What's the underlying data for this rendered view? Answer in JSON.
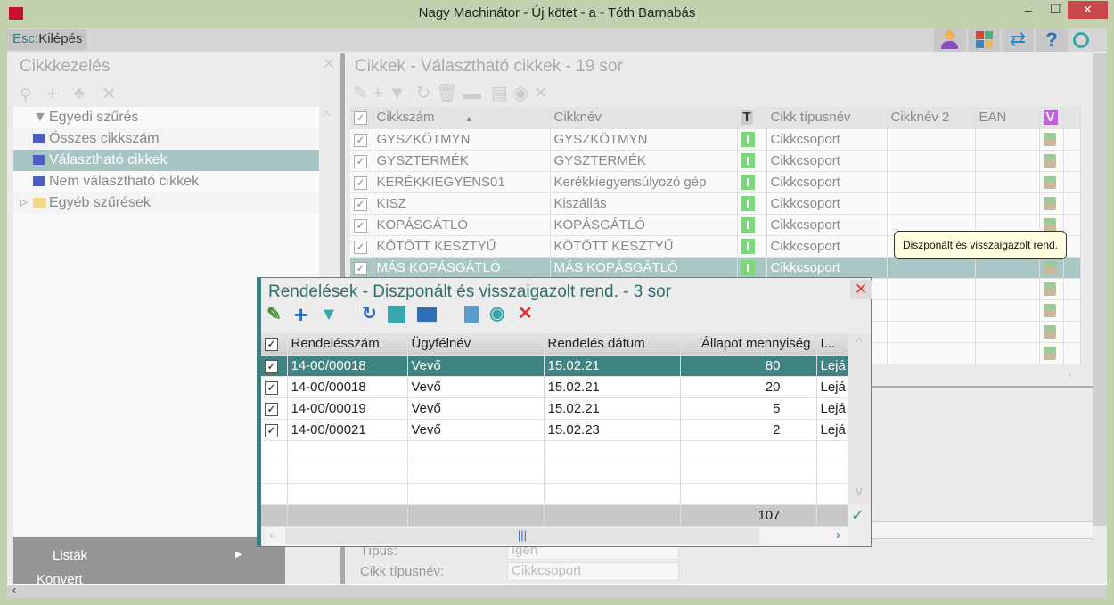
{
  "window": {
    "title": "Nagy Machinátor - Új kötet - a - Tóth Barnabás",
    "minimize": "–",
    "maximize": "☐",
    "close": "✕"
  },
  "menubar": {
    "esc_key": "Esc:",
    "esc_label": "Kilépés",
    "icons": [
      "user-icon",
      "tiles-icon",
      "swap-icon",
      "help-icon",
      "circle-icon"
    ]
  },
  "left_panel": {
    "title": "Cikkkezelés",
    "close": "✕",
    "items": [
      {
        "label": "Egyedi szűrés",
        "icon": "filter-icon"
      },
      {
        "label": "Összes cikkszám",
        "icon": "monitor-icon"
      },
      {
        "label": "Választható cikkek",
        "icon": "monitor-icon",
        "selected": true
      },
      {
        "label": "Nem választható cikkek",
        "icon": "monitor-icon"
      },
      {
        "label": "Egyéb szűrések",
        "icon": "folder-icon"
      }
    ],
    "bottom_menu": {
      "lists": "Listák",
      "convert": "Konvert"
    }
  },
  "main_grid": {
    "title": "Cikkek - Választható cikkek - 19 sor",
    "columns": [
      "Cikkszám",
      "Cikknév",
      "T",
      "Cikk típusnév",
      "Cikknév 2",
      "EAN",
      "V"
    ],
    "rows": [
      [
        "GYSZKÖTMYN",
        "GYSZKÖTMYN",
        "I",
        "Cikkcsoport",
        "",
        ""
      ],
      [
        "GYSZTERMÉK",
        "GYSZTERMÉK",
        "I",
        "Cikkcsoport",
        "",
        ""
      ],
      [
        "KERÉKKIEGYENS01",
        "Kerékkiegyensúlyozó gép",
        "I",
        "Cikkcsoport",
        "",
        ""
      ],
      [
        "KISZ",
        "Kiszállás",
        "I",
        "Cikkcsoport",
        "",
        ""
      ],
      [
        "KOPÁSGÁTLÓ",
        "KOPÁSGÁTLÓ",
        "I",
        "Cikkcsoport",
        "",
        ""
      ],
      [
        "KÖTÖTT KESZTYŰ",
        "KÖTÖTT KESZTYŰ",
        "I",
        "Cikkcsoport",
        "",
        ""
      ],
      [
        "MÁS KOPÁSGÁTLÓ",
        "MÁS KOPÁSGÁTLÓ",
        "I",
        "Cikkcsoport",
        "",
        ""
      ]
    ],
    "selected_row": 6,
    "tooltip": "Diszponált és visszaigazolt rend."
  },
  "detail_form": {
    "type_label": "Típus:",
    "type_value": "Igen",
    "typename_label": "Cikk típusnév:",
    "typename_value": "Cikkcsoport"
  },
  "popup": {
    "title": "Rendelések - Diszponált és visszaigazolt rend. - 3 sor",
    "close": "✕",
    "columns": [
      "Rendelésszám",
      "Ügyfélnév",
      "Rendelés dátum",
      "Állapot mennyiség",
      "I..."
    ],
    "rows": [
      [
        "14-00/00018",
        "Vevő",
        "15.02.21",
        "80",
        "Lejá"
      ],
      [
        "14-00/00018",
        "Vevő",
        "15.02.21",
        "20",
        "Lejá"
      ],
      [
        "14-00/00019",
        "Vevő",
        "15.02.21",
        "5",
        "Lejá"
      ],
      [
        "14-00/00021",
        "Vevő",
        "15.02.23",
        "2",
        "Lejá"
      ]
    ],
    "selected_row": 0,
    "total": "107",
    "accent": "#3f8482"
  }
}
